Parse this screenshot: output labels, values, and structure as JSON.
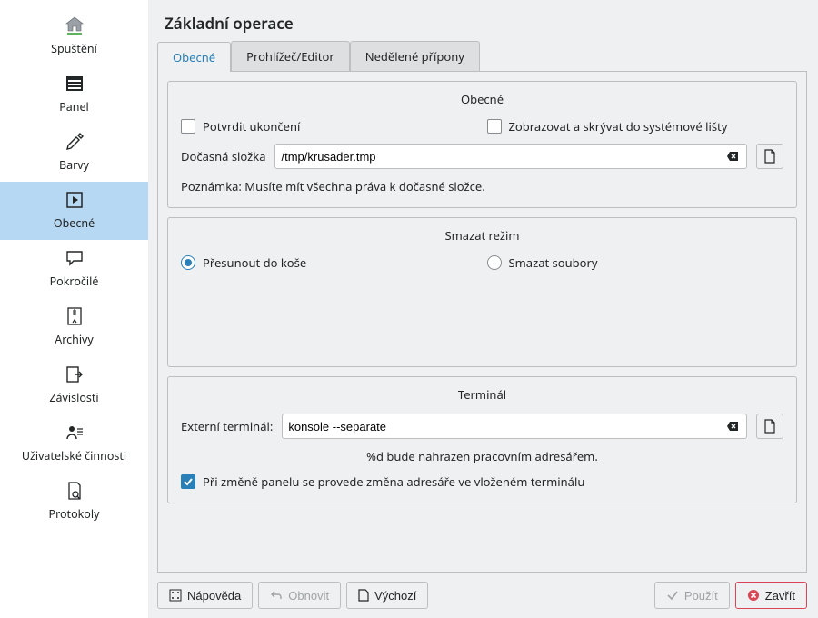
{
  "sidebar": {
    "items": [
      {
        "label": "Spuštění"
      },
      {
        "label": "Panel"
      },
      {
        "label": "Barvy"
      },
      {
        "label": "Obecné"
      },
      {
        "label": "Pokročilé"
      },
      {
        "label": "Archivy"
      },
      {
        "label": "Závislosti"
      },
      {
        "label": "Uživatelské činnosti"
      },
      {
        "label": "Protokoly"
      }
    ]
  },
  "page": {
    "title": "Základní operace"
  },
  "tabs": [
    {
      "label": "Obecné"
    },
    {
      "label": "Prohlížeč/Editor"
    },
    {
      "label": "Nedělené přípony"
    }
  ],
  "general": {
    "title": "Obecné",
    "confirm_exit": "Potvrdit ukončení",
    "show_hide_tray": "Zobrazovat a skrývat do systémové lišty",
    "temp_folder_label": "Dočasná složka",
    "temp_folder_value": "/tmp/krusader.tmp",
    "note": "Poznámka: Musíte mít všechna práva k dočasné složce."
  },
  "delete": {
    "title": "Smazat režim",
    "move_trash": "Přesunout do koše",
    "delete_files": "Smazat soubory"
  },
  "terminal": {
    "title": "Terminál",
    "external_label": "Externí terminál:",
    "external_value": "konsole --separate",
    "hint": "%d bude nahrazen pracovním adresářem.",
    "follow_panel": "Při změně panelu se provede změna adresáře ve vloženém terminálu"
  },
  "footer": {
    "help": "Nápověda",
    "reset": "Obnovit",
    "defaults": "Výchozí",
    "apply": "Použít",
    "close": "Zavřít"
  }
}
